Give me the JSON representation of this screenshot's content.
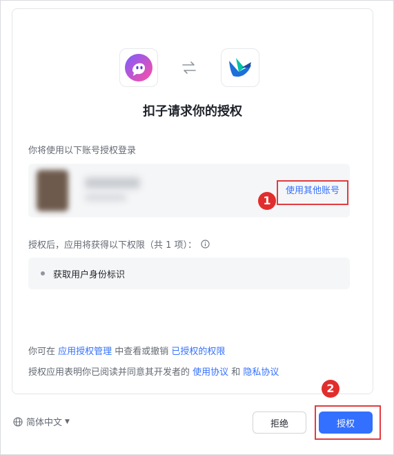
{
  "title": "扣子请求你的授权",
  "apps": {
    "left_icon": "coze-ghost-icon",
    "right_icon": "feishu-bird-icon",
    "swap_icon": "swap-arrows-icon"
  },
  "account_section": {
    "label": "你将使用以下账号授权登录",
    "switch_account": "使用其他账号",
    "callout_number": "1"
  },
  "permissions": {
    "label": "授权后，应用将获得以下权限（共 1 项）：",
    "items": [
      "获取用户身份标识"
    ]
  },
  "footer": {
    "line1_prefix": "你可在 ",
    "manage_link": "应用授权管理",
    "line1_middle": " 中查看或撤销 ",
    "revoke_link": "已授权的权限",
    "line2_prefix": "授权应用表明你已阅读并同意其开发者的 ",
    "terms_link": "使用协议",
    "line2_and": " 和 ",
    "privacy_link": "隐私协议"
  },
  "language": "简体中文",
  "buttons": {
    "reject": "拒绝",
    "authorize": "授权",
    "callout_number": "2"
  },
  "colors": {
    "primary": "#3370ff",
    "annotation_red": "#e23a3f"
  }
}
